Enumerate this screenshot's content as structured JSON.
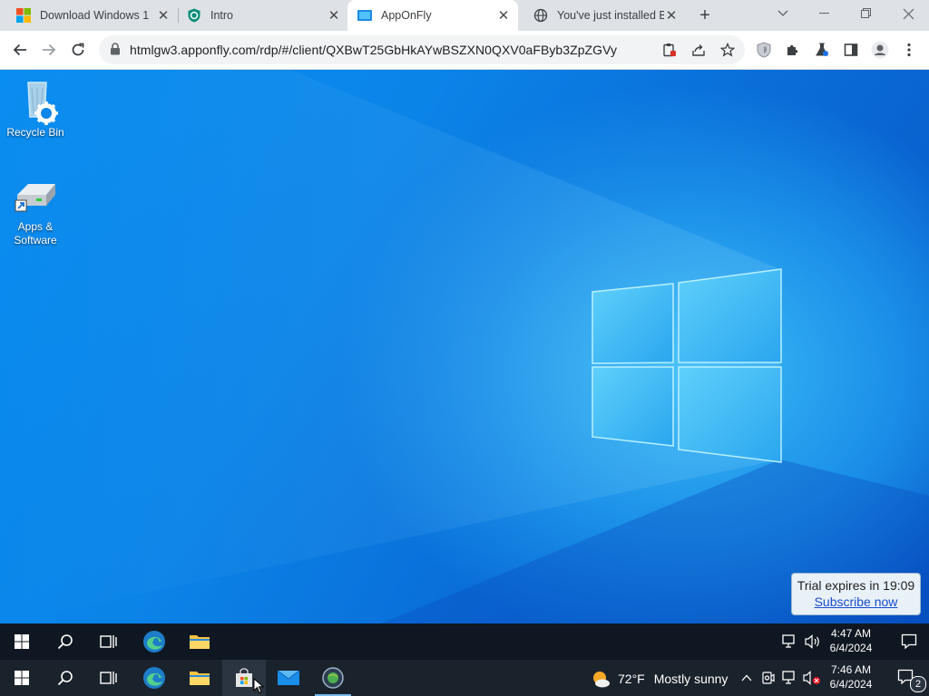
{
  "browser": {
    "tabs": [
      {
        "title": "Download Windows 1",
        "favicon": "microsoft-logo-icon"
      },
      {
        "title": "Intro",
        "favicon": "shield-check-icon"
      },
      {
        "title": "AppOnFly",
        "favicon": "apponfly-icon",
        "active": true
      },
      {
        "title": "You've just installed Bi",
        "favicon": "globe-icon"
      }
    ],
    "url": "htmlgw3.apponfly.com/rdp/#/client/QXBwT25GbHkAYwBSZXN0QXV0aFByb3ZpZGVy"
  },
  "desktop": {
    "icons": [
      {
        "label": "Recycle Bin",
        "icon": "recycle-bin-icon"
      },
      {
        "label": "Apps &\nSoftware",
        "icon": "drive-icon"
      }
    ],
    "trial": {
      "text": "Trial expires in 19:09",
      "link": "Subscribe now"
    }
  },
  "taskbar_top": {
    "time": "4:47 AM",
    "date": "6/4/2024"
  },
  "taskbar_bottom": {
    "weather_temp": "72°F",
    "weather_text": "Mostly sunny",
    "time": "7:46 AM",
    "date": "6/4/2024",
    "notifications": "2"
  },
  "colors": {
    "accent": "#1a73e8",
    "taskbar": "#101924",
    "desktop": "#0b84e8"
  }
}
